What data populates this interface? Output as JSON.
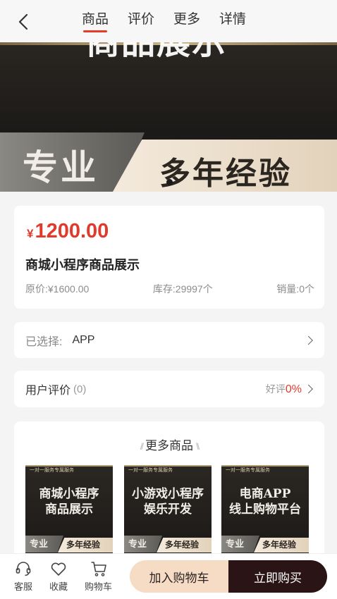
{
  "nav": {
    "tabs": [
      "商品",
      "评价",
      "更多",
      "详情"
    ]
  },
  "banner": {
    "title": "商品展示",
    "left_text": "专业",
    "right_text": "多年经验"
  },
  "product": {
    "currency": "¥",
    "price": "1200.00",
    "name": "商城小程序商品展示",
    "original_price": "原价:¥1600.00",
    "stock": "库存:29997个",
    "sales": "销量:0个"
  },
  "selection": {
    "label": "已选择:",
    "value": "APP"
  },
  "reviews": {
    "label": "用户评价",
    "count": "(0)",
    "good_label": "好评",
    "good_pct": "0%"
  },
  "more": {
    "title": "更多商品",
    "items": [
      {
        "top": "一对一服务专属服务",
        "line1": "商城小程序",
        "line2": "商品展示",
        "left": "专业",
        "right": "多年经验"
      },
      {
        "top": "一对一服务专属服务",
        "line1": "小游戏小程序",
        "line2": "娱乐开发",
        "left": "专业",
        "right": "多年经验"
      },
      {
        "top": "一对一服务专属服务",
        "line1": "电商APP",
        "line2": "线上购物平台",
        "left": "专业",
        "right": "多年经验"
      }
    ]
  },
  "bottom": {
    "service": "客服",
    "favorite": "收藏",
    "cart": "购物车",
    "add_cart": "加入购物车",
    "buy_now": "立即购买"
  },
  "colors": {
    "accent_red": "#e03a2c",
    "buy_button": "#2a1416",
    "cart_button": "#f6dbc5"
  }
}
